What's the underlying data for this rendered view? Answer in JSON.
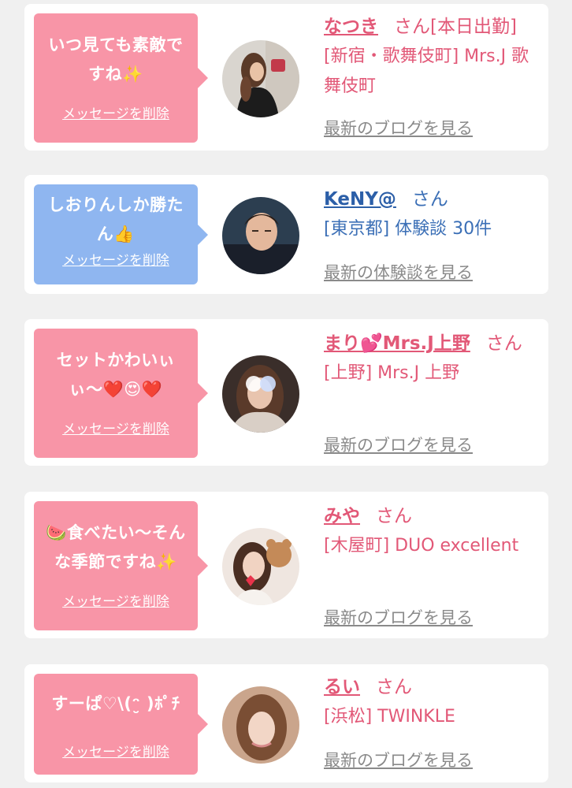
{
  "cards": [
    {
      "message": "いつ見ても素敵ですね✨",
      "delete_label": "メッセージを削除",
      "name": "なつき",
      "honorific": "さん",
      "status": "[本日出勤]",
      "detail": "[新宿・歌舞伎町] Mrs.J 歌舞伎町",
      "link": "最新のブログを見る",
      "bubble_color": "#f895a7"
    },
    {
      "message": "しおりんしか勝たん👍",
      "delete_label": "メッセージを削除",
      "name": "KeNY@",
      "honorific": "さん",
      "detail": "[東京都] 体験談 30件",
      "link": "最新の体験談を見る",
      "bubble_color": "#8fb6f0"
    },
    {
      "message": "セットかわいぃぃ〜❤️😍❤️",
      "delete_label": "メッセージを削除",
      "name": "まり💕Mrs.J上野",
      "honorific": "さん",
      "detail": "[上野] Mrs.J 上野",
      "link": "最新のブログを見る",
      "bubble_color": "#f895a7"
    },
    {
      "message": "🍉食べたい〜そんな季節ですね✨",
      "delete_label": "メッセージを削除",
      "name": "みや",
      "honorific": "さん",
      "detail": "[木屋町] DUO excellent",
      "link": "最新のブログを見る",
      "bubble_color": "#f895a7"
    },
    {
      "message": "すーぱ♡\\(ᵔ̮ )ﾎﾟﾁ",
      "delete_label": "メッセージを削除",
      "name": "るい",
      "honorific": "さん",
      "detail": "[浜松] TWINKLE",
      "link": "最新のブログを見る",
      "bubble_color": "#f895a7"
    }
  ]
}
